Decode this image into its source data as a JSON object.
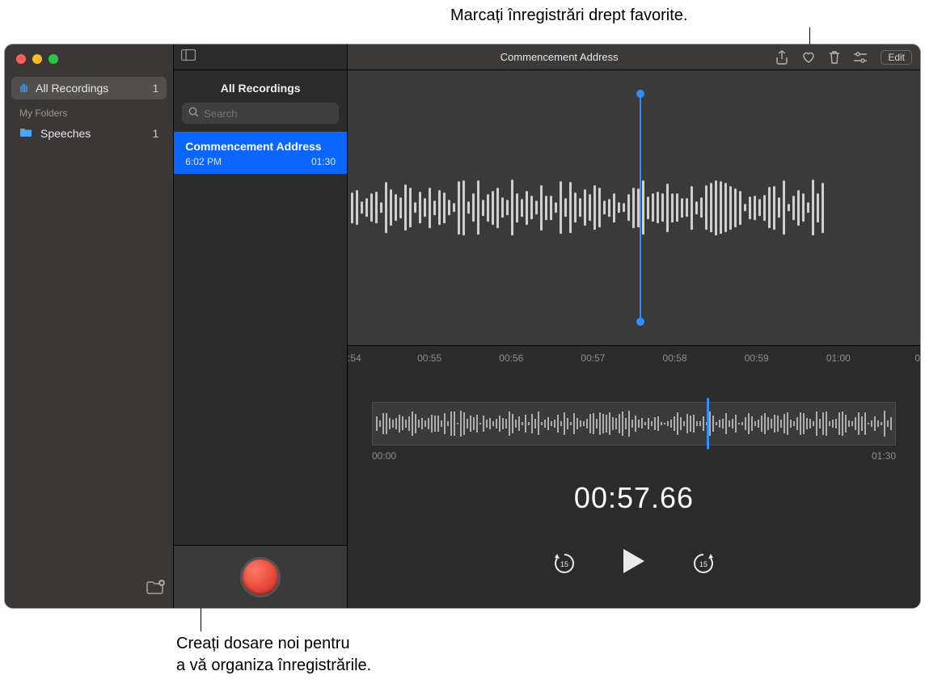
{
  "annotations": {
    "top": "Marcați înregistrări drept favorite.",
    "bottom_line1": "Creați dosare noi pentru",
    "bottom_line2": "a vă organiza înregistrările."
  },
  "sidebar": {
    "all_recordings_label": "All Recordings",
    "all_recordings_count": "1",
    "my_folders_header": "My Folders",
    "folders": [
      {
        "name": "Speeches",
        "count": "1"
      }
    ]
  },
  "list": {
    "title": "All Recordings",
    "search_placeholder": "Search",
    "items": [
      {
        "name": "Commencement Address",
        "time": "6:02 PM",
        "duration": "01:30"
      }
    ]
  },
  "editor": {
    "title": "Commencement Address",
    "edit_label": "Edit",
    "ruler_ticks": [
      ":54",
      "00:55",
      "00:56",
      "00:57",
      "00:58",
      "00:59",
      "01:00",
      "0"
    ],
    "mini_start": "00:00",
    "mini_end": "01:30",
    "timecode": "00:57.66",
    "skip_back": "15",
    "skip_fwd": "15",
    "playhead_big_pct": 51,
    "playhead_mini_pct": 64
  }
}
